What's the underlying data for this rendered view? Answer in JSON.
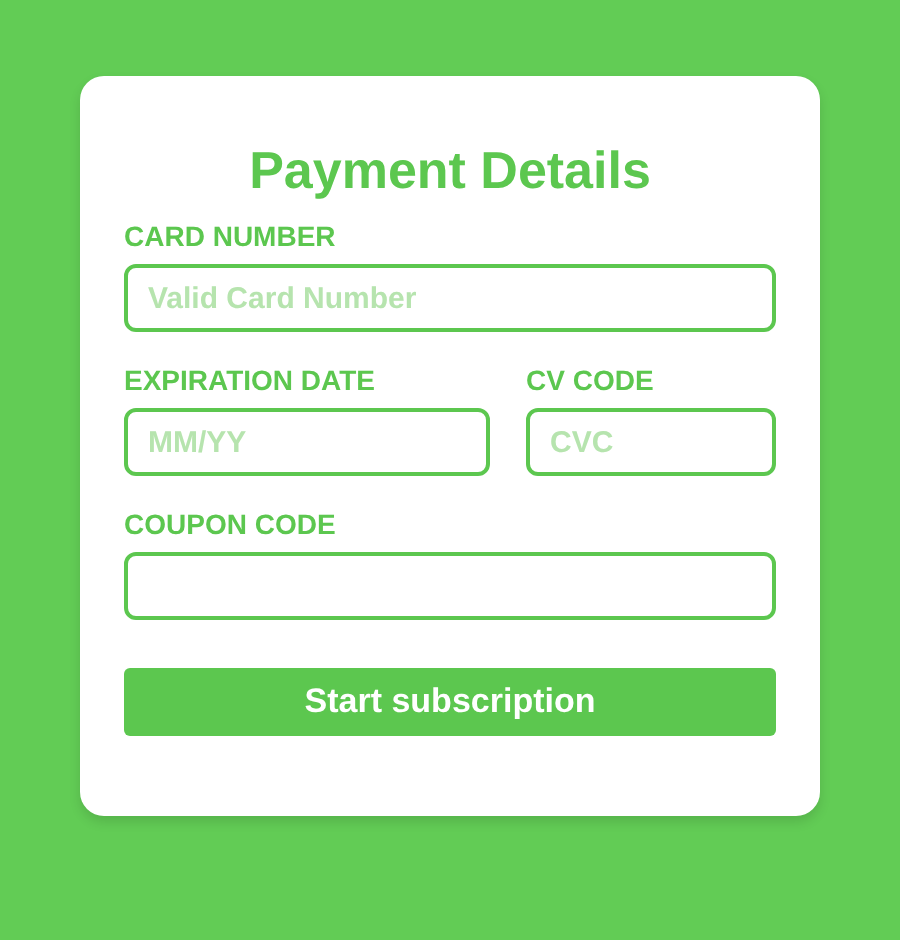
{
  "title": "Payment Details",
  "field_rows": [
    [
      {
        "label": "CARD NUMBER",
        "placeholder": "Valid Card Number"
      }
    ],
    [
      {
        "label": "EXPIRATION DATE",
        "placeholder": "MM/YY"
      },
      {
        "label": "CV CODE",
        "placeholder": "CVC"
      }
    ],
    [
      {
        "label": "COUPON CODE"
      }
    ]
  ],
  "button": "Start subscription"
}
